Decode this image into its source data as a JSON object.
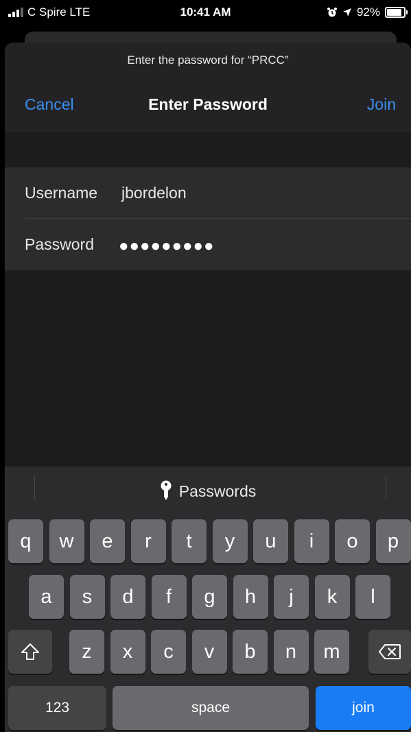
{
  "status_bar": {
    "carrier": "C Spire LTE",
    "time": "10:41 AM",
    "battery": "92%",
    "battery_level": 0.92,
    "icons": [
      "signal-icon",
      "alarm-icon",
      "location-icon",
      "battery-icon"
    ]
  },
  "dialog": {
    "prompt": "Enter the password for “PRCC”",
    "title": "Enter Password",
    "cancel_label": "Cancel",
    "join_label": "Join"
  },
  "form": {
    "username_label": "Username",
    "username_value": "jbordelon",
    "password_label": "Password",
    "password_value": "●●●●●●●●●"
  },
  "keyboard": {
    "quicktype_label": "Passwords",
    "row1": [
      "q",
      "w",
      "e",
      "r",
      "t",
      "y",
      "u",
      "i",
      "o",
      "p"
    ],
    "row2": [
      "a",
      "s",
      "d",
      "f",
      "g",
      "h",
      "j",
      "k",
      "l"
    ],
    "row3": [
      "z",
      "x",
      "c",
      "v",
      "b",
      "n",
      "m"
    ],
    "numbers_label": "123",
    "space_label": "space",
    "return_label": "join",
    "icons": [
      "shift-icon",
      "backspace-icon",
      "key-icon"
    ]
  },
  "colors": {
    "accent": "#3b8ff0",
    "return_key": "#1a7cf5",
    "background": "#1c1c1e"
  }
}
